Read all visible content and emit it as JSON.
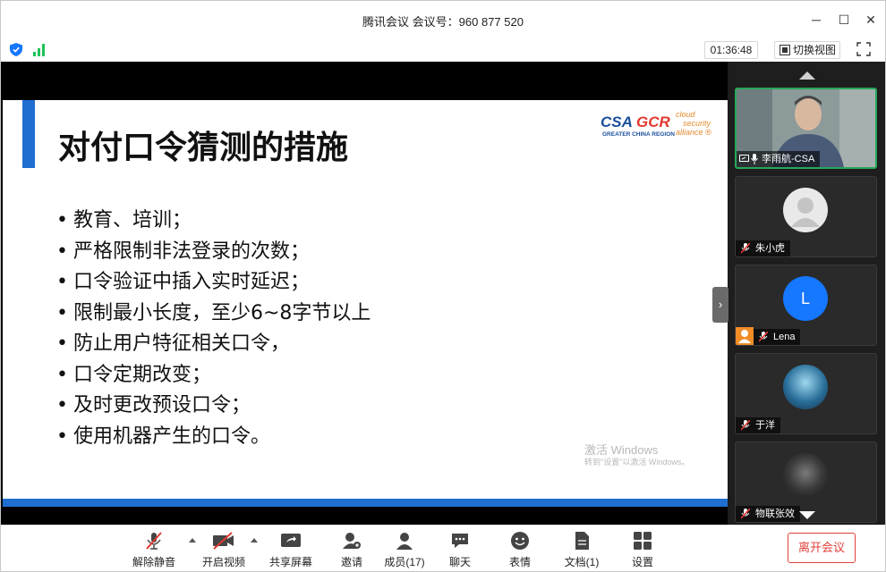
{
  "window": {
    "title": "腾讯会议 会议号：960 877 520",
    "controls": {
      "minimize": "─",
      "maximize": "☐",
      "close": "✕"
    }
  },
  "status": {
    "timer": "01:36:48",
    "switch_view": "切换视图",
    "security_icon": "shield-icon",
    "signal_icon": "network-signal-icon"
  },
  "slide": {
    "title": "对付口令猜测的措施",
    "logo": {
      "main": "CSA GCR",
      "sub": "GREATER CHINA REGION",
      "tag1": "cloud",
      "tag2": "security",
      "tag3": "alliance ®"
    },
    "bullets": [
      "教育、培训；",
      "严格限制非法登录的次数；",
      "口令验证中插入实时延迟；",
      "限制最小长度，至少6~8字节以上",
      "防止用户特征相关口令，",
      "口令定期改变；",
      "及时更改预设口令；",
      "使用机器产生的口令。"
    ],
    "watermark_line1": "激活 Windows",
    "watermark_line2": "转到\"设置\"以激活 Windows。",
    "accent_color": "#1f6fd0"
  },
  "participants": [
    {
      "name": "李雨航-CSA",
      "video": true,
      "speaking": true
    },
    {
      "name": "朱小虎",
      "muted": true
    },
    {
      "name": "Lena",
      "avatar_letter": "L",
      "muted": true,
      "avatar_color": "#1677ff"
    },
    {
      "name": "于洋",
      "muted": true
    },
    {
      "name": "物联张效",
      "muted": true
    }
  ],
  "toolbar": {
    "unmute": "解除静音",
    "start_video": "开启视频",
    "share_screen": "共享屏幕",
    "invite": "邀请",
    "members": "成员(17)",
    "chat": "聊天",
    "reactions": "表情",
    "docs": "文档(1)",
    "settings": "设置",
    "leave": "离开会议"
  }
}
